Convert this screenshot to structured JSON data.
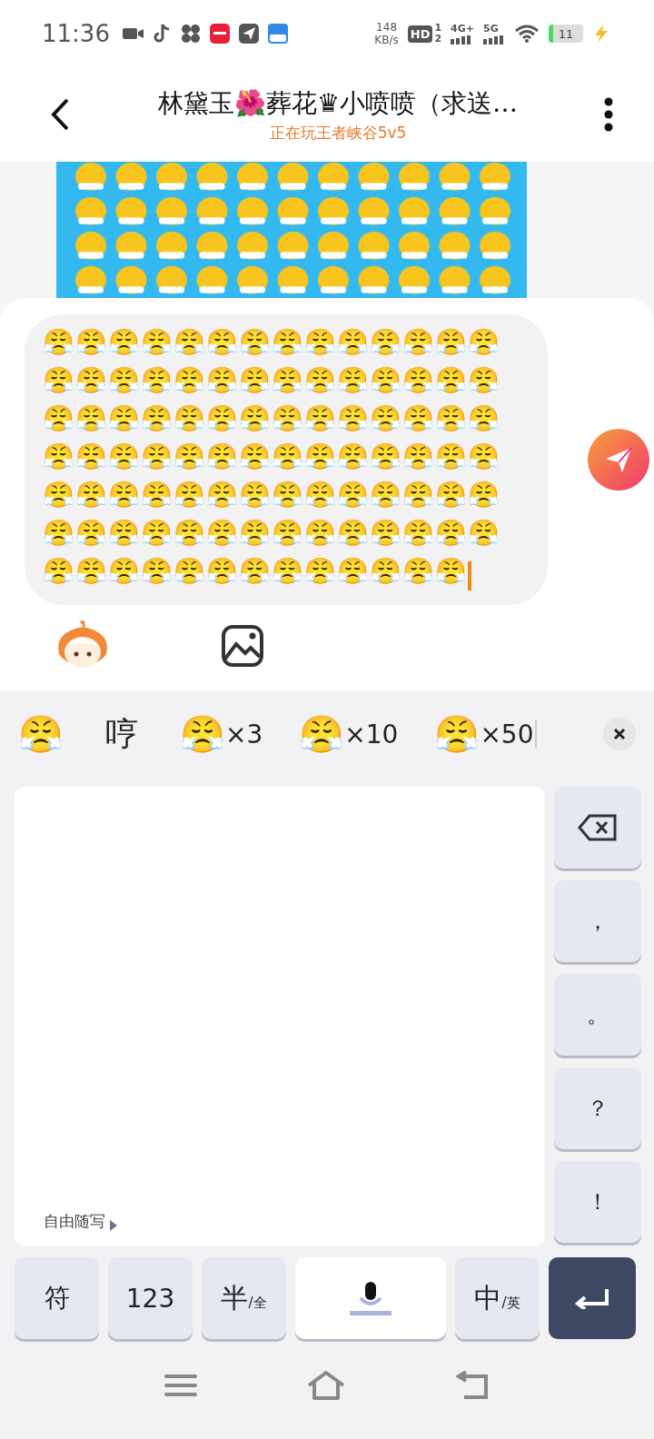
{
  "status_bar": {
    "time": "11:36",
    "net_speed": "148",
    "net_unit": "KB/s",
    "hd": "HD",
    "sim_1": "1",
    "sim_2": "2",
    "net_1": "4G+",
    "net_2": "5G",
    "battery": "11"
  },
  "header": {
    "title": "林黛玉🌺葬花♛小喷喷（求送…",
    "subtitle": "正在玩王者峡谷5v5"
  },
  "composer": {
    "value": "😤😤😤😤😤😤😤😤😤😤😤😤😤😤😤😤😤😤😤😤😤😤😤😤😤😤😤😤😤😤😤😤😤😤😤😤😤😤😤😤😤😤😤😤😤😤😤😤😤😤😤😤😤😤😤😤😤😤😤😤😤😤😤😤😤😤😤😤😤😤😤😤😤😤😤😤😤😤😤😤😤😤😤😤😤😤😤😤😤😤😤😤😤😤😤😤😤"
  },
  "suggestions": [
    {
      "emoji": "😤"
    },
    {
      "text": "哼"
    },
    {
      "emoji": "😤",
      "count": "×3"
    },
    {
      "emoji": "😤",
      "count": "×10"
    },
    {
      "emoji": "😤",
      "count": "×50"
    }
  ],
  "keyboard": {
    "handwriting_hint": "自由随写",
    "side_keys": [
      {
        "kind": "backspace"
      },
      {
        "kind": "char",
        "label": "，"
      },
      {
        "kind": "char",
        "label": "。"
      },
      {
        "kind": "char",
        "label": "？"
      },
      {
        "kind": "char",
        "label": "！"
      }
    ],
    "bottom_keys": [
      {
        "kind": "char",
        "label": "符"
      },
      {
        "kind": "char",
        "label": "123"
      },
      {
        "kind": "pair",
        "label": "半",
        "sub": "/全"
      },
      {
        "kind": "space"
      },
      {
        "kind": "pair",
        "label": "中",
        "sub": "/英"
      },
      {
        "kind": "enter"
      }
    ]
  }
}
